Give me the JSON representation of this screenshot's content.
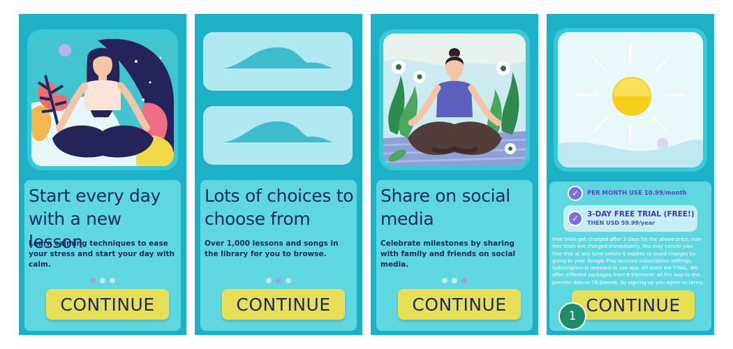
{
  "colors": {
    "screen_bg": "#1cb1c6",
    "card_bg": "#5fd7e1",
    "title_text": "#1d2a63",
    "button_bg": "#e7df56",
    "accent_purple": "#7b6fdc",
    "dot_active": "#a79be6"
  },
  "screens": [
    {
      "title": "Start every day with a new lesson",
      "description": "Learn calming techniques to ease your stress and start your day with calm.",
      "active_dot": 0,
      "button_label": "CONTINUE",
      "illustration": "meditating-woman-night-sky"
    },
    {
      "title": "Lots of choices to choose from",
      "description": "Over 1,000 lessons and songs in the library for you to browse.",
      "active_dot": 1,
      "button_label": "CONTINUE",
      "illustration": "cloud-placeholders"
    },
    {
      "title": "Share on social media",
      "description": "Celebrate milestones by sharing with family and friends on social media.",
      "active_dot": 2,
      "button_label": "CONTINUE",
      "illustration": "meditating-woman-garden"
    },
    {
      "illustration": "sun",
      "options": [
        {
          "label": "PER MONTH USE 10.99/month",
          "checked": true
        },
        {
          "label": "3-DAY FREE TRIAL (FREE!)",
          "sublabel": "THEN USD 59.99/year",
          "checked": true
        }
      ],
      "fine_print": "Free trials get charged after 3 days for the above price, non-free trials are charged immediately. You may cancel your free trial at any time before it expires to avoid charges by going to your Google Play account subscription settings. Subscription is required to use app. All sales are FINAL. We offer different packages from 9.99/month all the way to the premier deluxe 79.9/week. By signing up you agree to terms",
      "button_label": "CONTINUE",
      "badge_number": "1"
    }
  ]
}
